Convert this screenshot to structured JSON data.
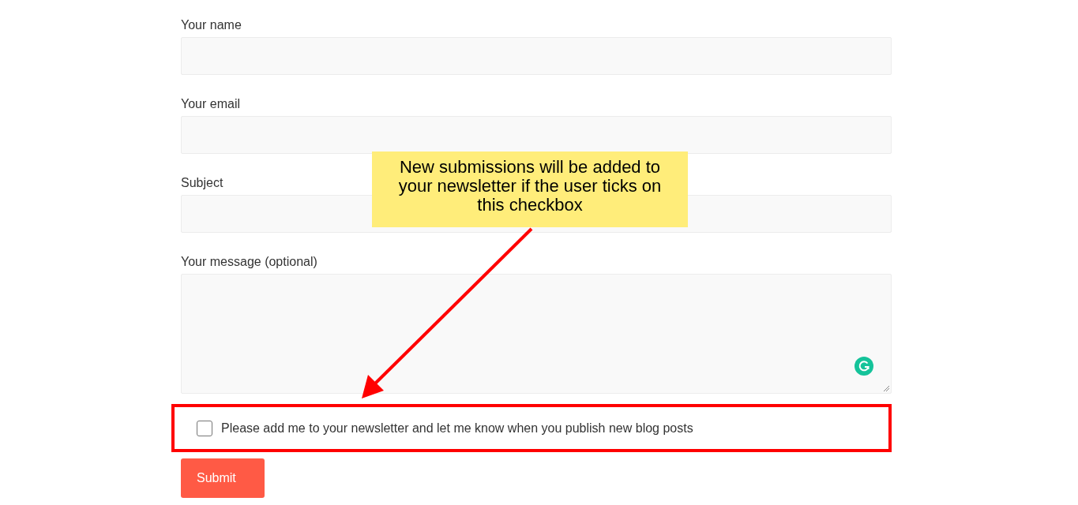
{
  "form": {
    "fields": [
      {
        "label": "Your name",
        "kind": "input"
      },
      {
        "label": "Your email",
        "kind": "input"
      },
      {
        "label": "Subject",
        "kind": "input"
      },
      {
        "label": "Your message (optional)",
        "kind": "textarea"
      }
    ],
    "newsletter": {
      "label": "Please add me to your newsletter and let me know when you publish new blog posts",
      "checked": false
    },
    "submit": "Submit"
  },
  "callout": {
    "text": "New submissions will be added to your newsletter if the user ticks on this checkbox"
  }
}
